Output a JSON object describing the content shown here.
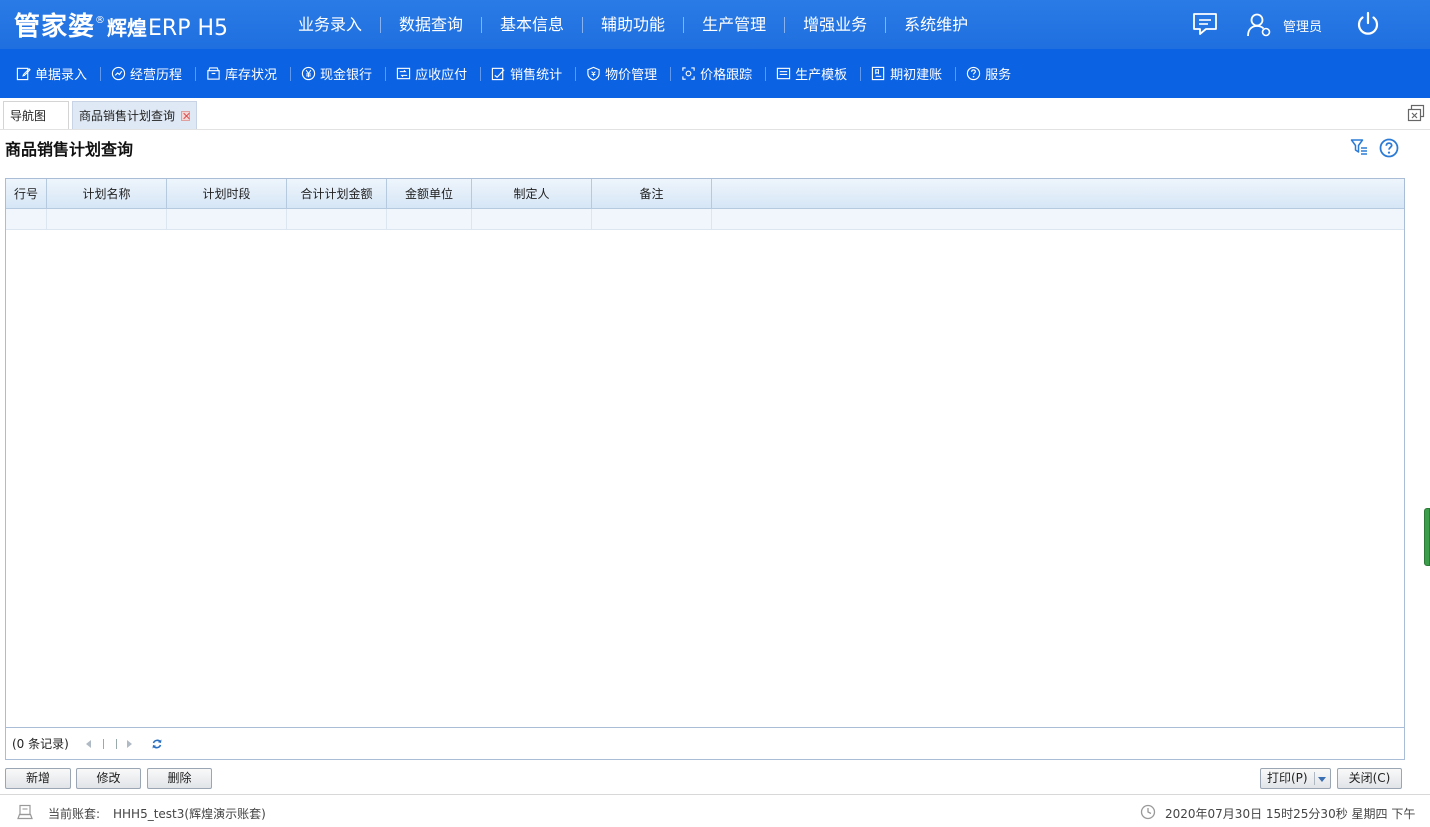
{
  "header": {
    "brand": "管家婆",
    "reg": "®",
    "product": "辉煌",
    "erp": "ERP H5",
    "nav": [
      "业务录入",
      "数据查询",
      "基本信息",
      "辅助功能",
      "生产管理",
      "增强业务",
      "系统维护"
    ],
    "user": "管理员"
  },
  "toolbar": {
    "items": [
      {
        "label": "单据录入",
        "icon": "edit-icon"
      },
      {
        "label": "经营历程",
        "icon": "trend-icon"
      },
      {
        "label": "库存状况",
        "icon": "inventory-icon"
      },
      {
        "label": "现金银行",
        "icon": "yen-icon"
      },
      {
        "label": "应收应付",
        "icon": "ledger-icon"
      },
      {
        "label": "销售统计",
        "icon": "sales-stat-icon"
      },
      {
        "label": "物价管理",
        "icon": "price-shield-icon"
      },
      {
        "label": "价格跟踪",
        "icon": "price-track-icon"
      },
      {
        "label": "生产模板",
        "icon": "template-icon"
      },
      {
        "label": "期初建账",
        "icon": "book-icon"
      },
      {
        "label": "服务",
        "icon": "help-circle-icon"
      }
    ]
  },
  "tabs": [
    {
      "label": "导航图",
      "active": false
    },
    {
      "label": "商品销售计划查询",
      "active": true
    }
  ],
  "page": {
    "title": "商品销售计划查询"
  },
  "grid": {
    "columns": [
      "行号",
      "计划名称",
      "计划时段",
      "合计计划金额",
      "金额单位",
      "制定人",
      "备注"
    ],
    "rows": [],
    "record_count": "(0 条记录)"
  },
  "buttons": {
    "add": "新增",
    "edit": "修改",
    "delete": "删除",
    "print": "打印(P)",
    "close": "关闭(C)"
  },
  "status": {
    "account_label": "当前账套:",
    "account_value": "HHH5_test3(辉煌演示账套)",
    "datetime": "2020年07月30日 15时25分30秒 星期四 下午"
  },
  "colors": {
    "header": "#2a7be6",
    "toolbar": "#0b62e3",
    "grid_header": "#d6e6f6",
    "grid_border": "#a9bed6"
  }
}
